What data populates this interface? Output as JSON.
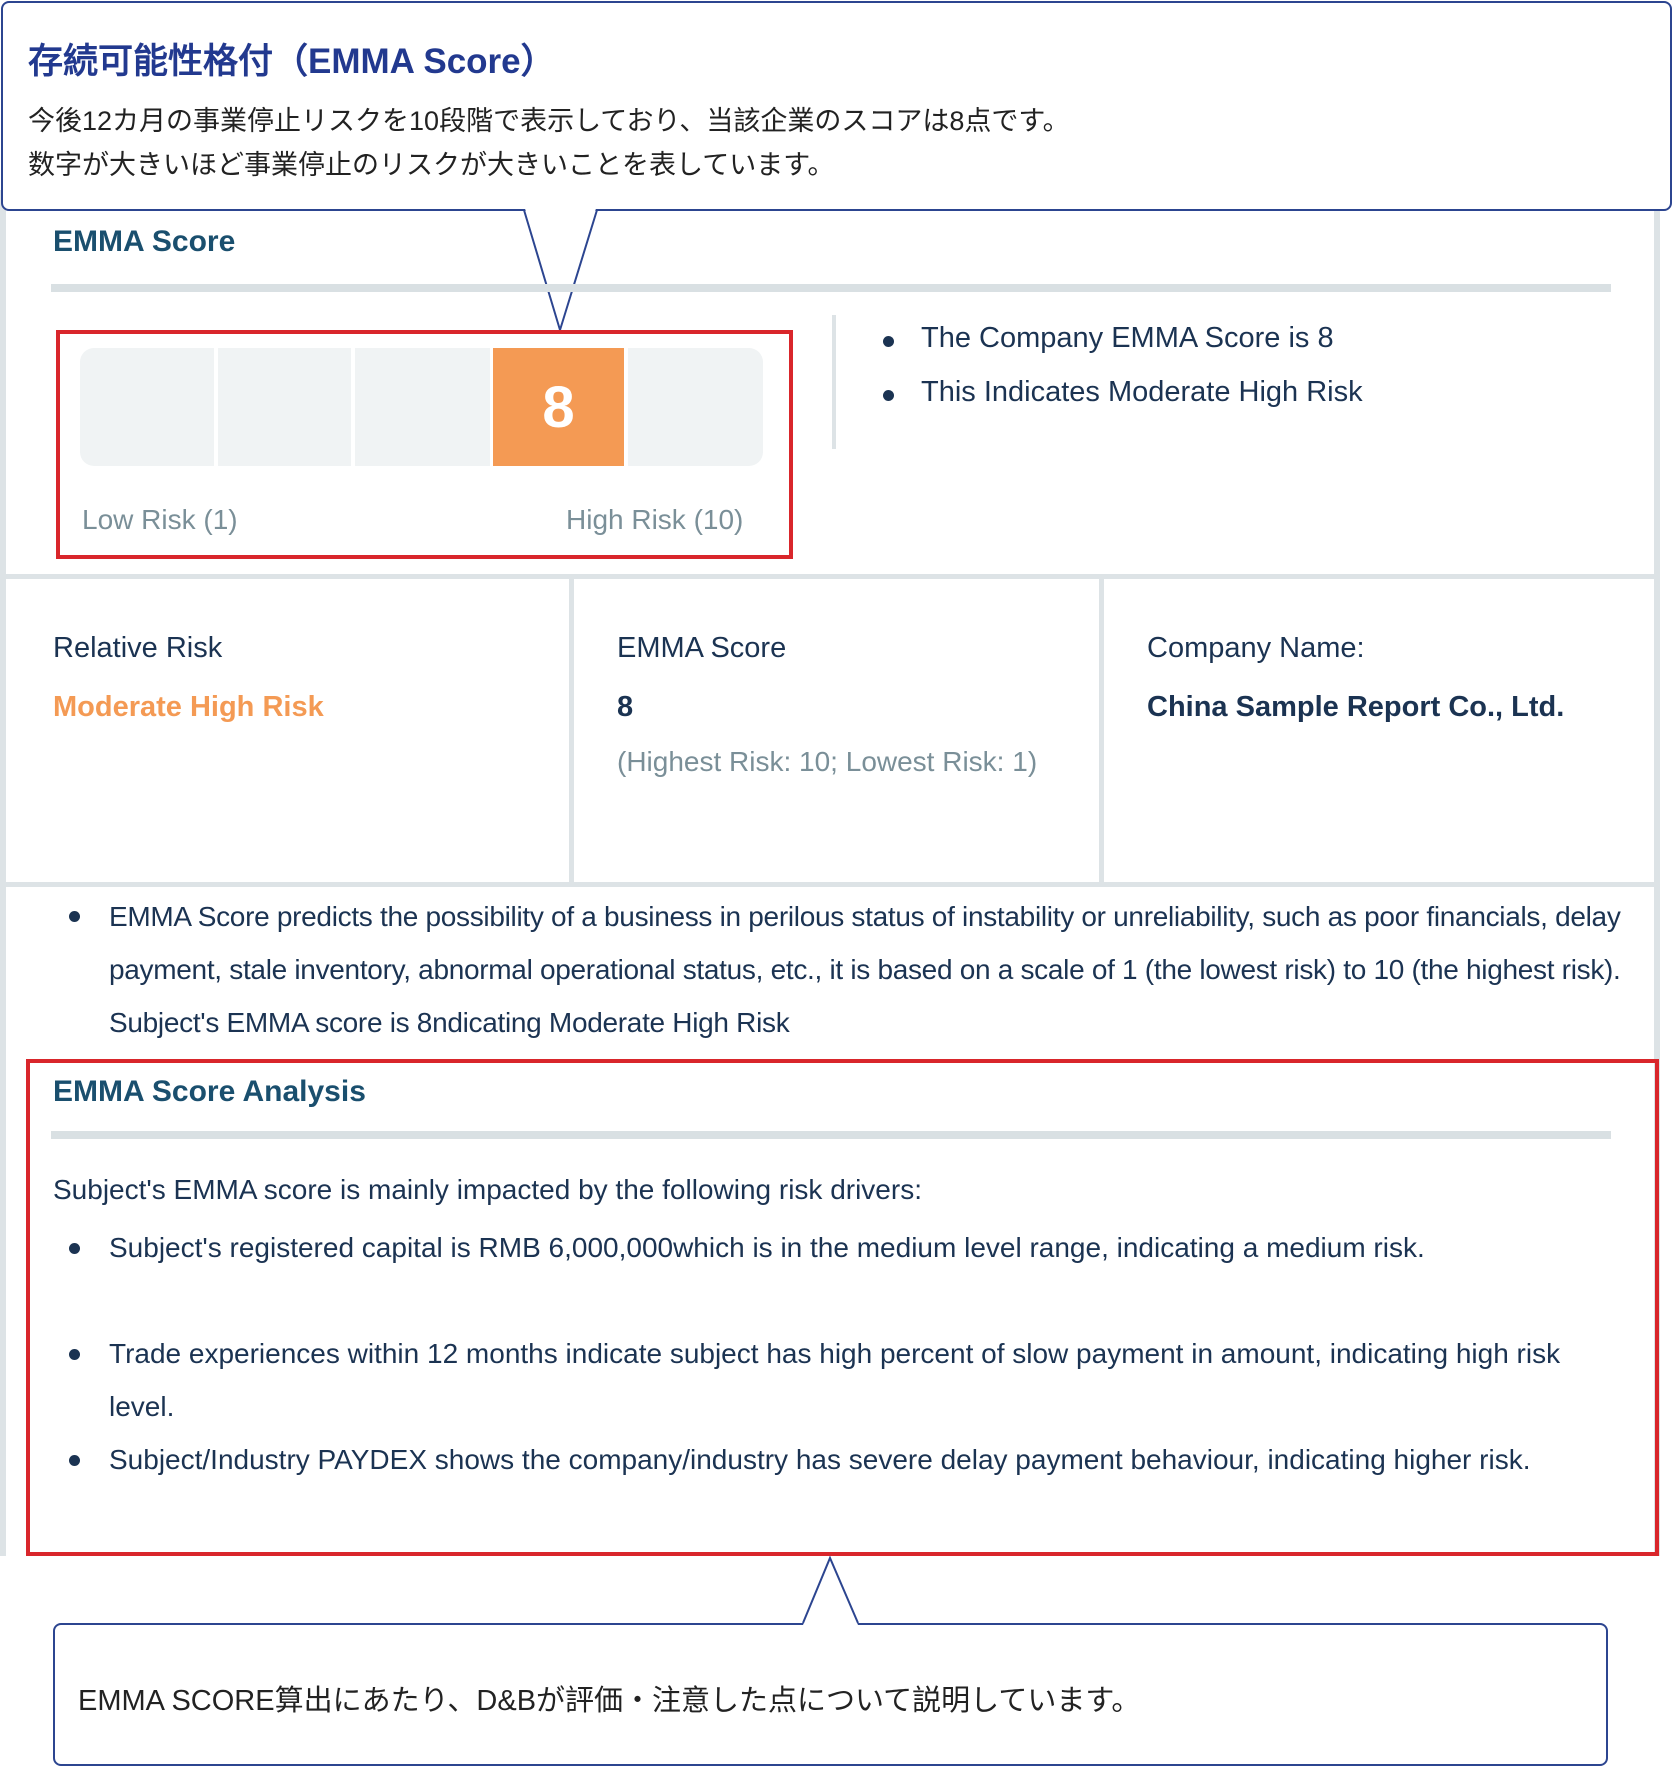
{
  "top_callout": {
    "title": "存続可能性格付（EMMA Score）",
    "line1": "今後12カ月の事業停止リスクを10段階で表示しており、当該企業のスコアは8点です。",
    "line2": "数字が大きいほど事業停止のリスクが大きいことを表しています。"
  },
  "emma_score_section": {
    "heading": "EMMA Score",
    "scale": {
      "value": "8",
      "segments": 5,
      "highlighted_segment": 4,
      "highlight_color": "#f49a54"
    },
    "low_label": "Low Risk (1)",
    "high_label": "High Risk (10)",
    "bullets": [
      "The Company EMMA Score is 8",
      "This Indicates Moderate High Risk"
    ]
  },
  "info_cells": {
    "relative_risk_label": "Relative Risk",
    "relative_risk_value": "Moderate High Risk",
    "emma_label": "EMMA Score",
    "emma_value": "8",
    "emma_note": "(Highest Risk: 10; Lowest Risk: 1)",
    "company_label": "Company Name:",
    "company_value": "China Sample Report Co., Ltd."
  },
  "description": "EMMA Score predicts the possibility of a business in perilous status of instability or unreliability, such as poor financials, delay payment, stale inventory, abnormal operational status, etc., it is based on a scale of 1 (the lowest risk) to 10 (the highest risk). Subject's EMMA score is 8ndicating Moderate High Risk",
  "analysis": {
    "heading": "EMMA Score Analysis",
    "intro": "Subject's EMMA score is mainly impacted by the following risk drivers:",
    "bullets": [
      "Subject's registered capital is RMB 6,000,000which is in the medium level range, indicating a medium risk.",
      "Trade experiences within 12 months indicate subject has high percent of slow payment in amount, indicating high risk level.",
      "Subject/Industry PAYDEX shows the company/industry has severe delay payment behaviour, indicating higher risk."
    ]
  },
  "bottom_callout": {
    "text": "EMMA SCORE算出にあたり、D&Bが評価・注意した点について説明しています。"
  },
  "colors": {
    "accent_orange": "#f49a54",
    "callout_border": "#2c4590",
    "highlight_border": "#d9262b"
  }
}
